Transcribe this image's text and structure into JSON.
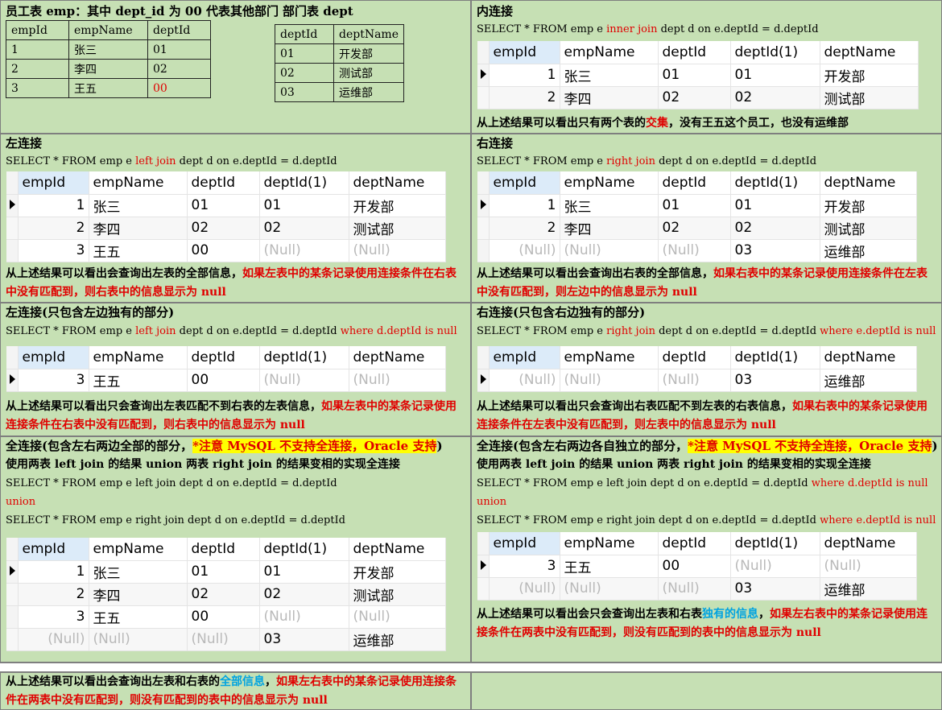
{
  "top_left": {
    "emp_title": "员工表 emp：其中 dept_id 为 00 代表其他部门",
    "dept_title": "部门表 dept",
    "emp_table": {
      "headers": [
        "empId",
        "empName",
        "deptId"
      ],
      "rows": [
        [
          "1",
          "张三",
          "01"
        ],
        [
          "2",
          "李四",
          "02"
        ],
        [
          "3",
          "王五",
          "00"
        ]
      ]
    },
    "dept_table": {
      "headers": [
        "deptId",
        "deptName"
      ],
      "rows": [
        [
          "01",
          "开发部"
        ],
        [
          "02",
          "测试部"
        ],
        [
          "03",
          "运维部"
        ]
      ]
    }
  },
  "grid_headers": [
    "empId",
    "empName",
    "deptId",
    "deptId(1)",
    "deptName"
  ],
  "null_text": "(Null)",
  "inner": {
    "title": "内连接",
    "sql_pre": "SELECT * FROM emp e ",
    "sql_kw": "inner join",
    "sql_post": " dept d on e.deptId = d.deptId",
    "note_a": "从上述结果可以看出只有两个表的",
    "note_b": "交集",
    "note_c": "，没有王五这个员工，也没有运维部"
  },
  "left": {
    "title": "左连接",
    "sql_pre": "SELECT * FROM emp e ",
    "sql_kw": "left join",
    "sql_post": " dept d on e.deptId = d.deptId",
    "note_a": "从上述结果可以看出会查询出左表的全部信息，",
    "note_b": "如果左表中的某条记录使用连接条件在右表中没有匹配到，则右表中的信息显示为 null"
  },
  "right": {
    "title": "右连接",
    "sql_pre": "SELECT * FROM emp e ",
    "sql_kw": "right join",
    "sql_post": " dept d on e.deptId = d.deptId",
    "note_a": "从上述结果可以看出会查询出右表的全部信息，",
    "note_b": "如果右表中的某条记录使用连接条件在左表中没有匹配到，则左边中的信息显示为 null"
  },
  "left_only": {
    "title": "左连接(只包含左边独有的部分)",
    "sql_pre": "SELECT * FROM emp e ",
    "sql_kw": "left join",
    "sql_mid": " dept d on e.deptId = d.deptId ",
    "sql_kw2": "where d.deptId is null",
    "note_a": "从上述结果可以看出只会查询出左表匹配不到右表的左表信息，",
    "note_b": "如果左表中的某条记录使用连接条件在右表中没有匹配到，则右表中的信息显示为 null"
  },
  "right_only": {
    "title": "右连接(只包含右边独有的部分)",
    "sql_pre": "SELECT * FROM emp e ",
    "sql_kw": "right join",
    "sql_mid": " dept d on e.deptId = d.deptId ",
    "sql_kw2": "where e.deptId is null",
    "note_a": "从上述结果可以看出只会查询出右表匹配不到左表的右表信息，",
    "note_b": "如果右表中的某条记录使用连接条件在左表中没有匹配到，则左表中的信息显示为 null"
  },
  "full": {
    "title_a": "全连接(包含左右两边全部的部分，",
    "title_hl": "*注意 MySQL 不支持全连接，Oracle 支持",
    "title_c": ")",
    "sub": "使用两表 left join 的结果 union 两表 right join 的结果变相的实现全连接",
    "sql1": "SELECT * FROM emp e left join dept d on e.deptId = d.deptId",
    "union": "union",
    "sql2": "SELECT * FROM emp e right join dept d on e.deptId = d.deptId",
    "note_a": "从上述结果可以看出会查询出左表和右表的",
    "note_b": "全部信息",
    "note_c": "，",
    "note_d": "如果左右表中的某条记录使用连接条件在两表中没有匹配到，则没有匹配到的表中的信息显示为 null"
  },
  "full_only": {
    "title_a": "全连接(包含左右两边各自独立的部分，",
    "title_hl": "*注意 MySQL 不支持全连接，Oracle 支持",
    "title_c": ")",
    "sub": "使用两表 left join 的结果 union 两表 right join 的结果变相的实现全连接",
    "sql1_pre": "SELECT * FROM emp e left join dept d on e.deptId = d.deptId ",
    "sql1_kw": "where d.deptId is null",
    "union": "union",
    "sql2_pre": "SELECT * FROM emp e right join dept d on e.deptId = d.deptId ",
    "sql2_kw": "where e.deptId is null",
    "note_a": "从上述结果可以看出会只会查询出左表和右表",
    "note_b": "独有的信息",
    "note_c": "，",
    "note_d": "如果左右表中的某条记录使用连接条件在两表中没有匹配到，则没有匹配到的表中的信息显示为 null"
  },
  "grids": {
    "inner": [
      [
        "1",
        "张三",
        "01",
        "01",
        "开发部"
      ],
      [
        "2",
        "李四",
        "02",
        "02",
        "测试部"
      ]
    ],
    "left": [
      [
        "1",
        "张三",
        "01",
        "01",
        "开发部"
      ],
      [
        "2",
        "李四",
        "02",
        "02",
        "测试部"
      ],
      [
        "3",
        "王五",
        "00",
        null,
        null
      ]
    ],
    "right": [
      [
        "1",
        "张三",
        "01",
        "01",
        "开发部"
      ],
      [
        "2",
        "李四",
        "02",
        "02",
        "测试部"
      ],
      [
        null,
        null,
        null,
        "03",
        "运维部"
      ]
    ],
    "left_only": [
      [
        "3",
        "王五",
        "00",
        null,
        null
      ]
    ],
    "right_only": [
      [
        null,
        null,
        null,
        "03",
        "运维部"
      ]
    ],
    "full": [
      [
        "1",
        "张三",
        "01",
        "01",
        "开发部"
      ],
      [
        "2",
        "李四",
        "02",
        "02",
        "测试部"
      ],
      [
        "3",
        "王五",
        "00",
        null,
        null
      ],
      [
        null,
        null,
        null,
        "03",
        "运维部"
      ]
    ],
    "full_only": [
      [
        "3",
        "王五",
        "00",
        null,
        null
      ],
      [
        null,
        null,
        null,
        "03",
        "运维部"
      ]
    ]
  },
  "colors": {
    "panel": "#c6e0b4",
    "keyword": "#e00000",
    "highlight": "#ffff00",
    "accent_blue": "#00a3e0"
  }
}
